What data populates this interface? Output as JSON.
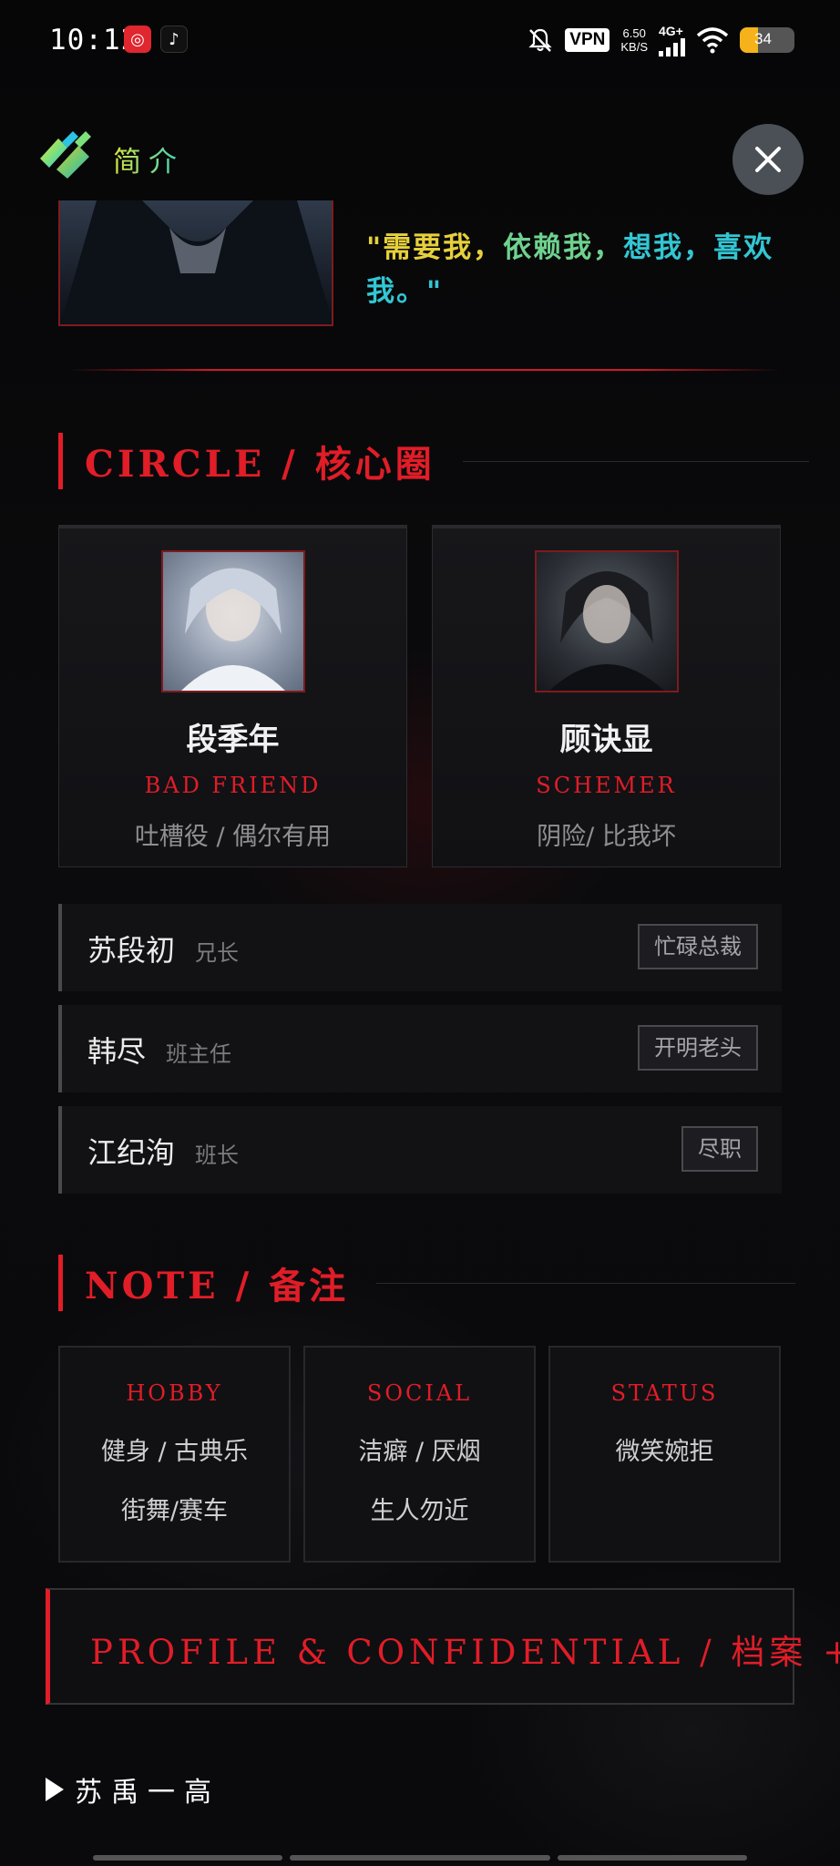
{
  "status_bar": {
    "time": "10:12",
    "apps": [
      "netease-music-icon",
      "tiktok-icon"
    ],
    "vpn": "VPN",
    "speed_value": "6.50",
    "speed_unit": "KB/S",
    "network": "4G+",
    "battery": "34",
    "battery_level": 0.34
  },
  "header": {
    "title": "简介"
  },
  "intro": {
    "quote_part1": "\"需要我，",
    "quote_part2": "依赖我，",
    "quote_part3": "想我，喜欢我。\""
  },
  "circle": {
    "heading": "CIRCLE / 核心圈",
    "cards": [
      {
        "name": "段季年",
        "role": "BAD FRIEND",
        "desc": "吐槽役 / 偶尔有用"
      },
      {
        "name": "顾诀显",
        "role": "SCHEMER",
        "desc": "阴险/ 比我坏"
      }
    ],
    "rows": [
      {
        "name": "苏段初",
        "relation": "兄长",
        "tag": "忙碌总裁"
      },
      {
        "name": "韩尽",
        "relation": "班主任",
        "tag": "开明老头"
      },
      {
        "name": "江纪洵",
        "relation": "班长",
        "tag": "尽职"
      }
    ]
  },
  "note": {
    "heading": "NOTE / 备注",
    "cards": [
      {
        "title": "HOBBY",
        "line1": "健身 / 古典乐",
        "line2": "街舞/赛车"
      },
      {
        "title": "SOCIAL",
        "line1": "洁癖 / 厌烟",
        "line2": "生人勿近"
      },
      {
        "title": "STATUS",
        "line1": "微笑婉拒",
        "line2": ""
      }
    ]
  },
  "profile_button": "PROFILE & CONFIDENTIAL / 档案 +",
  "footer": "苏禹一高",
  "colors": {
    "accent_red": "#e11d27",
    "background": "#08080a"
  }
}
